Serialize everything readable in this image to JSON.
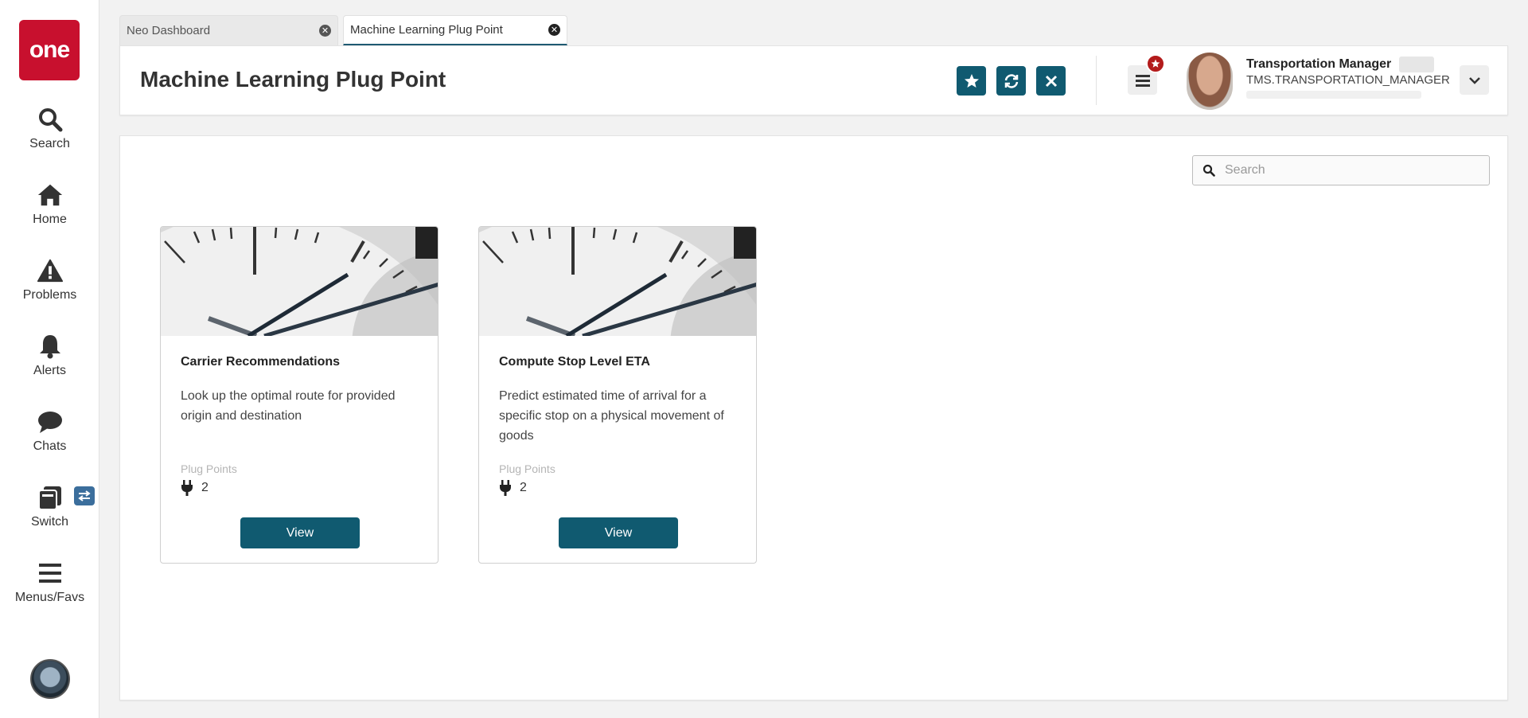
{
  "sidebar": {
    "logo_text": "one",
    "items": [
      {
        "label": "Search",
        "icon": "search-icon"
      },
      {
        "label": "Home",
        "icon": "home-icon"
      },
      {
        "label": "Problems",
        "icon": "warning-icon"
      },
      {
        "label": "Alerts",
        "icon": "bell-icon"
      },
      {
        "label": "Chats",
        "icon": "chat-icon"
      },
      {
        "label": "Switch",
        "icon": "switch-icon"
      },
      {
        "label": "Menus/Favs",
        "icon": "menu-icon"
      }
    ]
  },
  "tabs": [
    {
      "label": "Neo Dashboard",
      "active": false
    },
    {
      "label": "Machine Learning Plug Point",
      "active": true
    }
  ],
  "header": {
    "title": "Machine Learning Plug Point",
    "user": {
      "name": "Transportation Manager",
      "role": "TMS.TRANSPORTATION_MANAGER"
    }
  },
  "search": {
    "placeholder": "Search",
    "value": ""
  },
  "cards": [
    {
      "title": "Carrier Recommendations",
      "description": "Look up the optimal route for provided origin and destination",
      "plug_points_label": "Plug Points",
      "plug_points_count": "2",
      "button_label": "View"
    },
    {
      "title": "Compute Stop Level ETA",
      "description": "Predict estimated time of arrival for a specific stop on a physical movement of goods",
      "plug_points_label": "Plug Points",
      "plug_points_count": "2",
      "button_label": "View"
    }
  ],
  "colors": {
    "brand_red": "#c8102e",
    "primary_teal": "#105a70",
    "badge_red": "#b31b1b",
    "switch_blue": "#3b6e9c"
  }
}
